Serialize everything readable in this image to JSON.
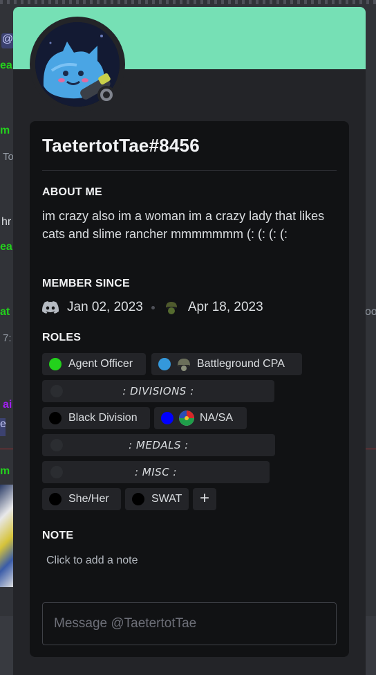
{
  "background": {
    "fragments": [
      "@",
      "ea",
      "m",
      "To",
      "hr",
      "ea",
      "at",
      "7:",
      "ai",
      "e",
      "m",
      "oo"
    ]
  },
  "profile": {
    "username": "TaetertotTae#8456",
    "banner_color": "#76e0b5",
    "status": "offline",
    "about": {
      "title": "ABOUT ME",
      "text": "im crazy also im a woman im a crazy lady that likes cats and slime rancher mmmmmmm (: (: (: (:"
    },
    "member_since": {
      "title": "MEMBER SINCE",
      "discord_date": "Jan 02, 2023",
      "server_date": "Apr 18, 2023",
      "discord_icon": "discord-icon",
      "server_icon": "server-icon"
    },
    "roles": {
      "title": "ROLES",
      "items": [
        {
          "label": "Agent Officer",
          "color": "#23d11c"
        },
        {
          "label": "Battleground CPA",
          "color": "#3498db",
          "emoji": "helmet-emoji"
        },
        {
          "label": ": DIVISIONS :",
          "color": "#2b2d31",
          "separator": true
        },
        {
          "label": "Black Division",
          "color": "#000000"
        },
        {
          "label": "NA/SA",
          "color": "#0000ff",
          "emoji": "flag-emoji"
        },
        {
          "label": ": MEDALS :",
          "color": "#2b2d31",
          "separator": true
        },
        {
          "label": ": MISC :",
          "color": "#2b2d31",
          "separator": true
        },
        {
          "label": "She/Her",
          "color": "#000000"
        },
        {
          "label": "SWAT",
          "color": "#000000"
        }
      ],
      "add_label": "+"
    },
    "note": {
      "title": "NOTE",
      "placeholder": "Click to add a note"
    },
    "message": {
      "placeholder": "Message @TaetertotTae"
    }
  }
}
